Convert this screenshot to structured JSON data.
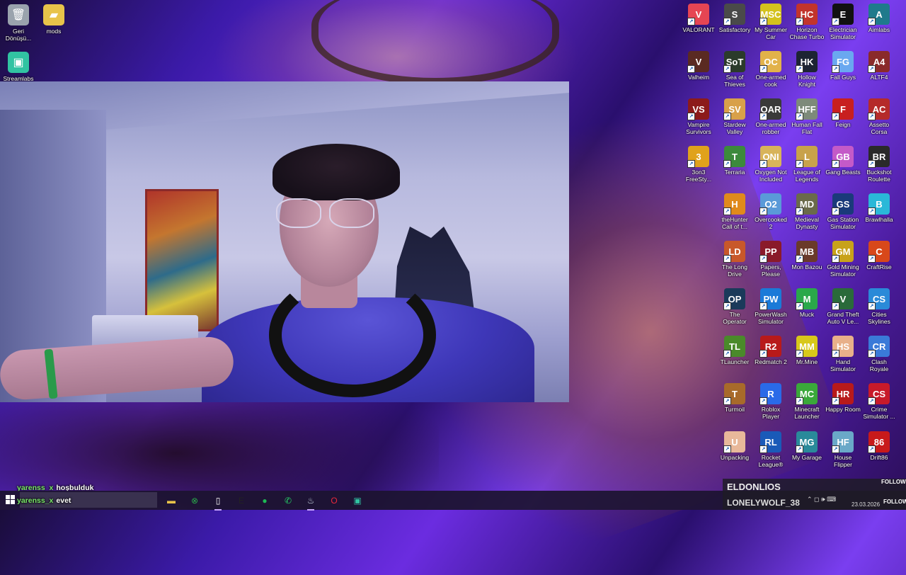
{
  "left_icons": [
    {
      "label": "Geri Dönüşü...",
      "icon": "recycle-bin-icon",
      "color": "#9aa3ad"
    },
    {
      "label": "mods",
      "icon": "folder-icon",
      "color": "#e8c34a"
    },
    {
      "label": "Streamlabs",
      "icon": "streamlabs-icon",
      "color": "#31c3a2"
    }
  ],
  "desktop_icons": [
    {
      "label": "VALORANT",
      "icon": "valorant-icon",
      "color": "#e64553",
      "glyph": "V"
    },
    {
      "label": "Satisfactory",
      "icon": "satisfactory-icon",
      "color": "#4a4a4a",
      "glyph": "S"
    },
    {
      "label": "My Summer Car",
      "icon": "my-summer-car-icon",
      "color": "#d4c21d",
      "glyph": "MSC"
    },
    {
      "label": "Horizon Chase Turbo",
      "icon": "horizon-chase-icon",
      "color": "#c2342c",
      "glyph": "HC"
    },
    {
      "label": "Electrician Simulator",
      "icon": "electrician-icon",
      "color": "#111111",
      "glyph": "E"
    },
    {
      "label": "Aimlabs",
      "icon": "aimlabs-icon",
      "color": "#1f7a8c",
      "glyph": "A"
    },
    {
      "label": "Valheim",
      "icon": "valheim-icon",
      "color": "#5a2a22",
      "glyph": "V"
    },
    {
      "label": "Sea of Thieves",
      "icon": "sea-of-thieves-icon",
      "color": "#2b3b2b",
      "glyph": "SoT"
    },
    {
      "label": "One-armed cook",
      "icon": "one-armed-cook-icon",
      "color": "#e2b24a",
      "glyph": "OC"
    },
    {
      "label": "Hollow Knight",
      "icon": "hollow-knight-icon",
      "color": "#1d2433",
      "glyph": "HK"
    },
    {
      "label": "Fall Guys",
      "icon": "fall-guys-icon",
      "color": "#6aa8f0",
      "glyph": "FG"
    },
    {
      "label": "ALTF4",
      "icon": "altf4-icon",
      "color": "#8a2a2a",
      "glyph": "A4"
    },
    {
      "label": "Vampire Survivors",
      "icon": "vampire-survivors-icon",
      "color": "#8c1a1a",
      "glyph": "VS"
    },
    {
      "label": "Stardew Valley",
      "icon": "stardew-valley-icon",
      "color": "#d8a04a",
      "glyph": "SV"
    },
    {
      "label": "One-armed robber",
      "icon": "one-armed-robber-icon",
      "color": "#3a3a3a",
      "glyph": "OAR"
    },
    {
      "label": "Human Fall Flat",
      "icon": "human-fall-flat-icon",
      "color": "#7d8a7a",
      "glyph": "HFF"
    },
    {
      "label": "Feign",
      "icon": "feign-icon",
      "color": "#c81f1f",
      "glyph": "F"
    },
    {
      "label": "Assetto Corsa",
      "icon": "assetto-corsa-icon",
      "color": "#b52a2a",
      "glyph": "AC"
    },
    {
      "label": "3on3 FreeSty...",
      "icon": "3on3-freestyle-icon",
      "color": "#e0a21c",
      "glyph": "3"
    },
    {
      "label": "Terraria",
      "icon": "terraria-icon",
      "color": "#3c8a3c",
      "glyph": "T"
    },
    {
      "label": "Oxygen Not Included",
      "icon": "oxygen-not-included-icon",
      "color": "#d8b45a",
      "glyph": "ONI"
    },
    {
      "label": "League of Legends",
      "icon": "league-of-legends-icon",
      "color": "#c8a24a",
      "glyph": "L"
    },
    {
      "label": "Gang Beasts",
      "icon": "gang-beasts-icon",
      "color": "#c45ac8",
      "glyph": "GB"
    },
    {
      "label": "Buckshot Roulette",
      "icon": "buckshot-roulette-icon",
      "color": "#2a2a2a",
      "glyph": "BR"
    },
    {
      "label": "theHunter Call of t...",
      "icon": "thehunter-icon",
      "color": "#e08a1c",
      "glyph": "H"
    },
    {
      "label": "Overcooked 2",
      "icon": "overcooked-icon",
      "color": "#5a9ad8",
      "glyph": "O2"
    },
    {
      "label": "Medieval Dynasty",
      "icon": "medieval-dynasty-icon",
      "color": "#6a6a4a",
      "glyph": "MD"
    },
    {
      "label": "Gas Station Simulator",
      "icon": "gas-station-icon",
      "color": "#1a3a7a",
      "glyph": "GS"
    },
    {
      "label": "Brawlhalla",
      "icon": "brawlhalla-icon",
      "color": "#2ab8d8",
      "glyph": "B"
    },
    {
      "label": "The Long Drive",
      "icon": "long-drive-icon",
      "color": "#c8582a",
      "glyph": "LD"
    },
    {
      "label": "Papers, Please",
      "icon": "papers-please-icon",
      "color": "#8a1a2a",
      "glyph": "PP"
    },
    {
      "label": "Mon Bazou",
      "icon": "mon-bazou-icon",
      "color": "#6a3a2a",
      "glyph": "MB"
    },
    {
      "label": "Gold Mining Simulator",
      "icon": "gold-mining-icon",
      "color": "#c8a21a",
      "glyph": "GM"
    },
    {
      "label": "CraftRise",
      "icon": "craftrise-icon",
      "color": "#d8481a",
      "glyph": "C"
    },
    {
      "label": "The Operator",
      "icon": "the-operator-icon",
      "color": "#1a3a5a",
      "glyph": "OP"
    },
    {
      "label": "PowerWash Simulator",
      "icon": "powerwash-icon",
      "color": "#1a7ad8",
      "glyph": "PW"
    },
    {
      "label": "Muck",
      "icon": "muck-icon",
      "color": "#2aa84a",
      "glyph": "M"
    },
    {
      "label": "Grand Theft Auto V Le...",
      "icon": "gta-v-icon",
      "color": "#2a6a3a",
      "glyph": "V"
    },
    {
      "label": "Cities Skylines",
      "icon": "cities-skylines-icon",
      "color": "#2a8ad8",
      "glyph": "CS"
    },
    {
      "label": "TLauncher",
      "icon": "tlauncher-icon",
      "color": "#4a8a2a",
      "glyph": "TL"
    },
    {
      "label": "Redmatch 2",
      "icon": "redmatch-icon",
      "color": "#b81a1a",
      "glyph": "R2"
    },
    {
      "label": "Mr.Mine",
      "icon": "mr-mine-icon",
      "color": "#d8c81a",
      "glyph": "MM"
    },
    {
      "label": "Hand Simulator",
      "icon": "hand-simulator-icon",
      "color": "#e8b08a",
      "glyph": "HS"
    },
    {
      "label": "Clash Royale",
      "icon": "clash-royale-icon",
      "color": "#3a7ad8",
      "glyph": "CR"
    },
    {
      "label": "Turmoil",
      "icon": "turmoil-icon",
      "color": "#a86a2a",
      "glyph": "T"
    },
    {
      "label": "Roblox Player",
      "icon": "roblox-icon",
      "color": "#2a6ae8",
      "glyph": "R"
    },
    {
      "label": "Minecraft Launcher",
      "icon": "minecraft-icon",
      "color": "#3aa83a",
      "glyph": "MC"
    },
    {
      "label": "Happy Room",
      "icon": "happy-room-icon",
      "color": "#b81a1a",
      "glyph": "HR"
    },
    {
      "label": "Crime Simulator ...",
      "icon": "crime-simulator-icon",
      "color": "#c81a2a",
      "glyph": "CS"
    },
    {
      "label": "Unpacking",
      "icon": "unpacking-icon",
      "color": "#e8b89a",
      "glyph": "U"
    },
    {
      "label": "Rocket League®",
      "icon": "rocket-league-icon",
      "color": "#1a5ab8",
      "glyph": "RL"
    },
    {
      "label": "My Garage",
      "icon": "my-garage-icon",
      "color": "#2a8a9a",
      "glyph": "MG"
    },
    {
      "label": "House Flipper",
      "icon": "house-flipper-icon",
      "color": "#6aa8c8",
      "glyph": "HF"
    },
    {
      "label": "Drift86",
      "icon": "drift86-icon",
      "color": "#c81a1a",
      "glyph": "86"
    }
  ],
  "chat": [
    {
      "user": "yarenss_x",
      "message": "hoşbulduk"
    },
    {
      "user": "yarenss_x",
      "message": "evet"
    }
  ],
  "followers": {
    "name1": "ELDONLIOS",
    "name2": "LONELYWOLF_38",
    "follow_label": "FOLLOW"
  },
  "taskbar": {
    "apps": [
      {
        "name": "file-explorer-icon",
        "glyph": "▬",
        "color": "#e8c34a"
      },
      {
        "name": "xbox-icon",
        "glyph": "⊗",
        "color": "#2aa84a"
      },
      {
        "name": "notepad-icon",
        "glyph": "▯",
        "color": "#ffffff"
      },
      {
        "name": "epic-games-icon",
        "glyph": "E",
        "color": "#222222"
      },
      {
        "name": "spotify-icon",
        "glyph": "●",
        "color": "#1db954"
      },
      {
        "name": "whatsapp-icon",
        "glyph": "✆",
        "color": "#25d366"
      },
      {
        "name": "steam-icon",
        "glyph": "♨",
        "color": "#c7d5e0"
      },
      {
        "name": "opera-gx-icon",
        "glyph": "O",
        "color": "#e8283c"
      },
      {
        "name": "streamlabs-taskbar-icon",
        "glyph": "▣",
        "color": "#31c3a2"
      }
    ],
    "date": "23.03.2026",
    "tray_glyphs": "⌃  ◻  🕪  ⌨"
  }
}
